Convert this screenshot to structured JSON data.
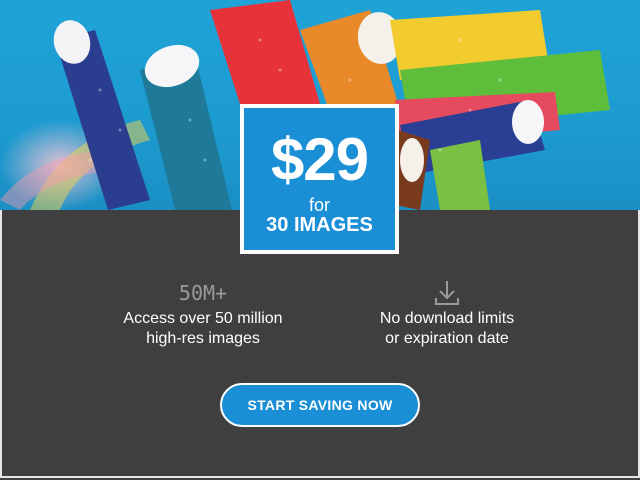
{
  "offer": {
    "price": "$29",
    "for_text": "for",
    "quantity": "30 IMAGES"
  },
  "features": [
    {
      "stat": "50M+",
      "line1": "Access over 50 million",
      "line2": "high-res images"
    },
    {
      "icon": "download-icon",
      "line1": "No download limits",
      "line2": "or expiration date"
    }
  ],
  "cta": {
    "label": "START SAVING NOW"
  },
  "colors": {
    "brand_blue": "#1a8fd6",
    "panel_gray": "#3f3f3f",
    "sky_blue": "#1d9bd0"
  }
}
